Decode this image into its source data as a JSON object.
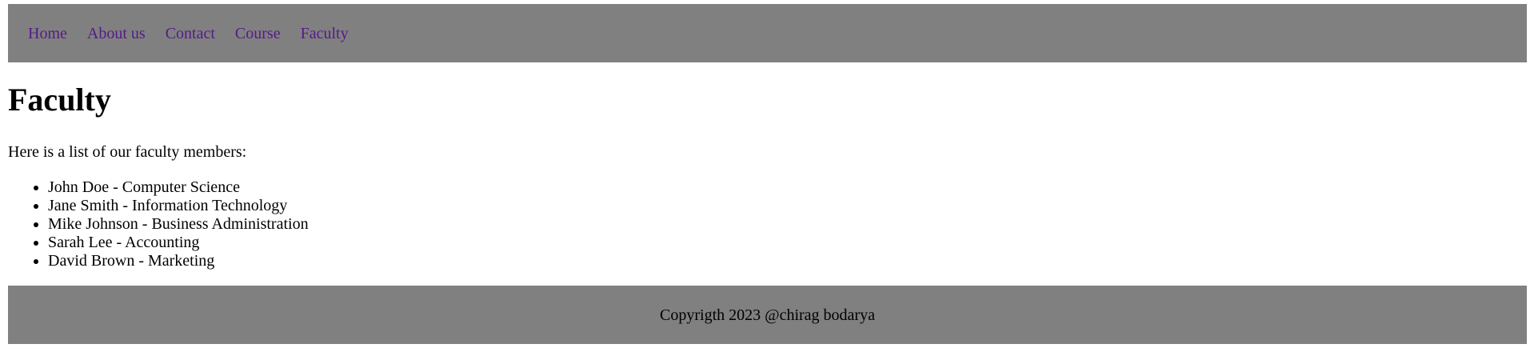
{
  "nav": {
    "items": [
      {
        "label": "Home"
      },
      {
        "label": "About us"
      },
      {
        "label": "Contact"
      },
      {
        "label": "Course"
      },
      {
        "label": "Faculty"
      }
    ]
  },
  "main": {
    "title": "Faculty",
    "intro": "Here is a list of our faculty members:",
    "faculty": [
      "John Doe - Computer Science",
      "Jane Smith - Information Technology",
      "Mike Johnson - Business Administration",
      "Sarah Lee - Accounting",
      "David Brown - Marketing"
    ]
  },
  "footer": {
    "text": "Copyrigth 2023 @chirag bodarya"
  },
  "colors": {
    "bar_background": "#808080",
    "link_visited": "#551a8b",
    "text": "#000000",
    "page_background": "#ffffff"
  }
}
